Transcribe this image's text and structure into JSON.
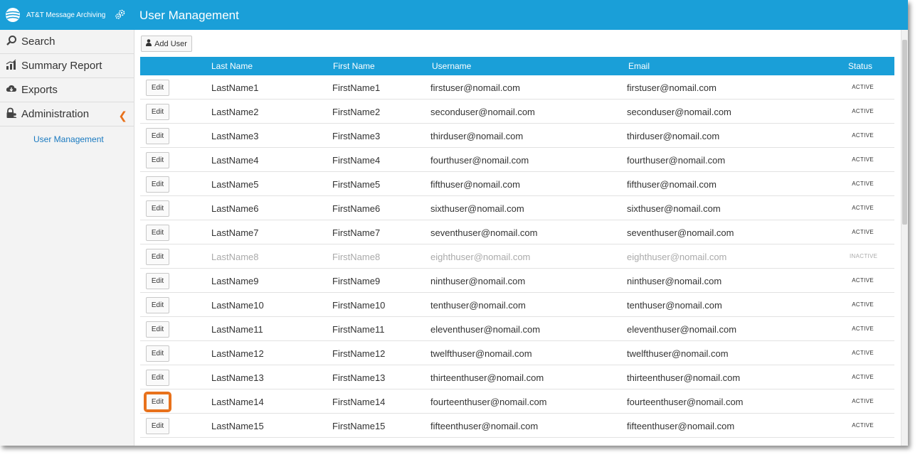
{
  "header": {
    "brand": "AT&T Message Archiving",
    "title": "User Management",
    "accent": "#1a9fd8"
  },
  "sidebar": {
    "items": [
      {
        "label": "Search",
        "icon": "search-icon"
      },
      {
        "label": "Summary Report",
        "icon": "bar-chart-icon"
      },
      {
        "label": "Exports",
        "icon": "cloud-download-icon"
      },
      {
        "label": "Administration",
        "icon": "lock-user-icon"
      }
    ],
    "sub_items": [
      {
        "label": "User Management"
      }
    ]
  },
  "toolbar": {
    "add_user_label": "Add User"
  },
  "table": {
    "columns": [
      "Last Name",
      "First Name",
      "Username",
      "Email",
      "Status"
    ],
    "edit_label": "Edit",
    "rows": [
      {
        "last": "LastName1",
        "first": "FirstName1",
        "user": "firstuser@nomail.com",
        "email": "firstuser@nomail.com",
        "status": "ACTIVE"
      },
      {
        "last": "LastName2",
        "first": "FirstName2",
        "user": "seconduser@nomail.com",
        "email": "seconduser@nomail.com",
        "status": "ACTIVE"
      },
      {
        "last": "LastName3",
        "first": "FirstName3",
        "user": "thirduser@nomail.com",
        "email": "thirduser@nomail.com",
        "status": "ACTIVE"
      },
      {
        "last": "LastName4",
        "first": "FirstName4",
        "user": "fourthuser@nomail.com",
        "email": "fourthuser@nomail.com",
        "status": "ACTIVE"
      },
      {
        "last": "LastName5",
        "first": "FirstName5",
        "user": "fifthuser@nomail.com",
        "email": "fifthuser@nomail.com",
        "status": "ACTIVE"
      },
      {
        "last": "LastName6",
        "first": "FirstName6",
        "user": "sixthuser@nomail.com",
        "email": "sixthuser@nomail.com",
        "status": "ACTIVE"
      },
      {
        "last": "LastName7",
        "first": "FirstName7",
        "user": "seventhuser@nomail.com",
        "email": "seventhuser@nomail.com",
        "status": "ACTIVE"
      },
      {
        "last": "LastName8",
        "first": "FirstName8",
        "user": "eighthuser@nomail.com",
        "email": "eighthuser@nomail.com",
        "status": "INACTIVE"
      },
      {
        "last": "LastName9",
        "first": "FirstName9",
        "user": "ninthuser@nomail.com",
        "email": "ninthuser@nomail.com",
        "status": "ACTIVE"
      },
      {
        "last": "LastName10",
        "first": "FirstName10",
        "user": "tenthuser@nomail.com",
        "email": "tenthuser@nomail.com",
        "status": "ACTIVE"
      },
      {
        "last": "LastName11",
        "first": "FirstName11",
        "user": "eleventhuser@nomail.com",
        "email": "eleventhuser@nomail.com",
        "status": "ACTIVE"
      },
      {
        "last": "LastName12",
        "first": "FirstName12",
        "user": "twelfthuser@nomail.com",
        "email": "twelfthuser@nomail.com",
        "status": "ACTIVE"
      },
      {
        "last": "LastName13",
        "first": "FirstName13",
        "user": "thirteenthuser@nomail.com",
        "email": "thirteenthuser@nomail.com",
        "status": "ACTIVE"
      },
      {
        "last": "LastName14",
        "first": "FirstName14",
        "user": "fourteenthuser@nomail.com",
        "email": "fourteenthuser@nomail.com",
        "status": "ACTIVE"
      },
      {
        "last": "LastName15",
        "first": "FirstName15",
        "user": "fifteenthuser@nomail.com",
        "email": "fifteenthuser@nomail.com",
        "status": "ACTIVE"
      }
    ]
  }
}
